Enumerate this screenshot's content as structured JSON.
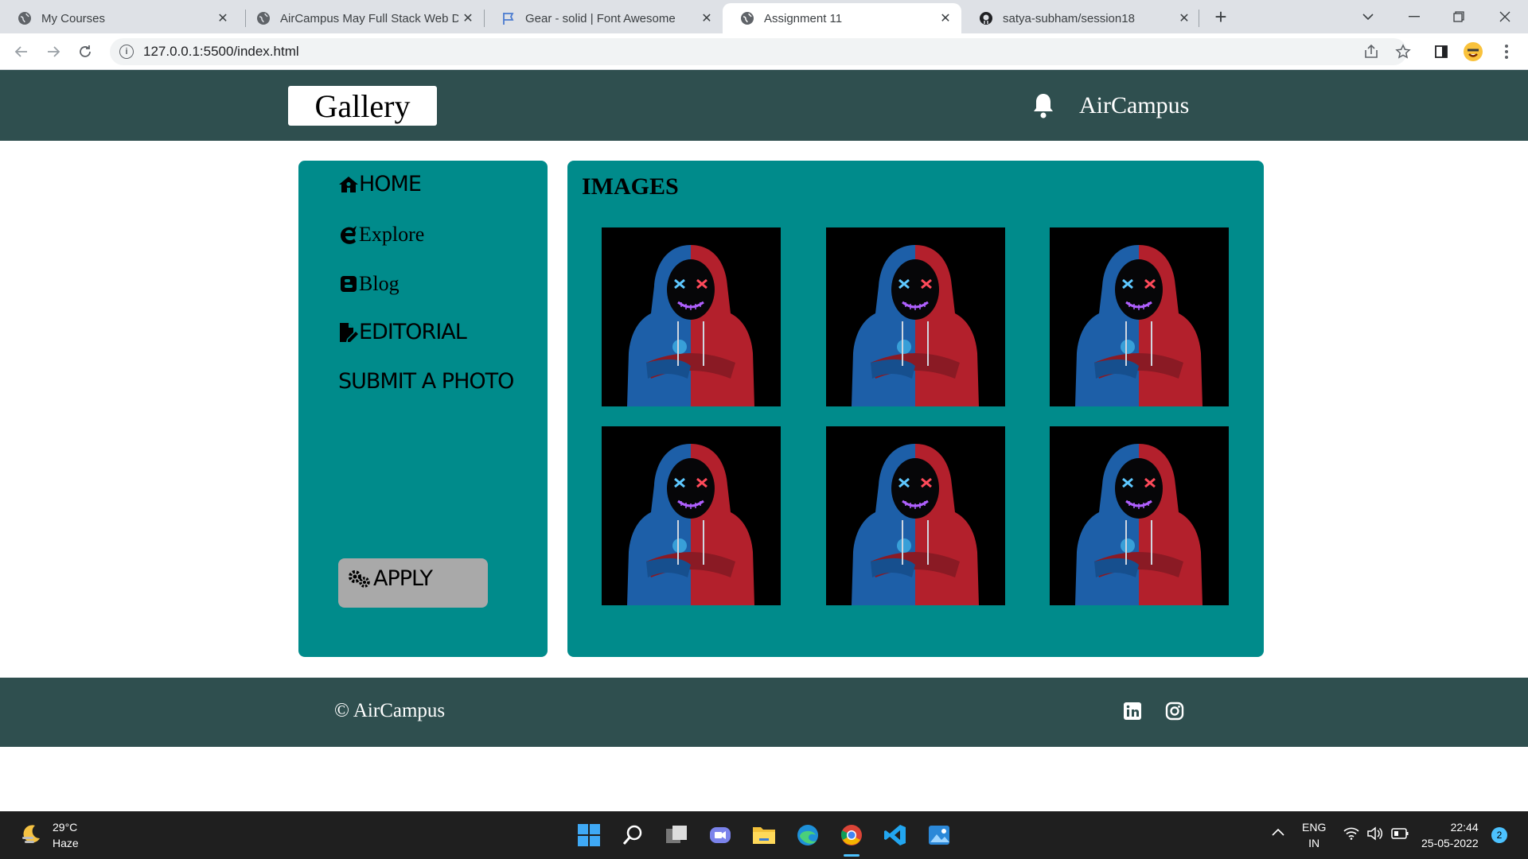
{
  "browser": {
    "tabs": [
      {
        "title": "My Courses"
      },
      {
        "title": "AirCampus May Full Stack Web D"
      },
      {
        "title": "Gear - solid | Font Awesome"
      },
      {
        "title": "Assignment 11"
      },
      {
        "title": "satya-subham/session18"
      }
    ],
    "address": "127.0.0.1:5500/index.html"
  },
  "header": {
    "logo": "Gallery",
    "brand": "AirCampus"
  },
  "sidebar": {
    "items": [
      {
        "label": "HOME",
        "icon": "house-icon"
      },
      {
        "label": "Explore",
        "icon": "internet-explorer-icon"
      },
      {
        "label": "Blog",
        "icon": "blogger-icon"
      },
      {
        "label": "EDITORIAL",
        "icon": "file-pen-icon"
      },
      {
        "label": "SUBMIT A PHOTO",
        "icon": ""
      }
    ],
    "apply_label": "APPLY"
  },
  "main": {
    "title": "IMAGES",
    "image_count": 6
  },
  "footer": {
    "copyright": "© AirCampus"
  },
  "taskbar": {
    "temperature": "29°C",
    "condition": "Haze",
    "lang_top": "ENG",
    "lang_bottom": "IN",
    "time": "22:44",
    "date": "25-05-2022",
    "notifications": "2"
  },
  "colors": {
    "header_bg": "#2f4f4f",
    "panel_bg": "#008b8b",
    "apply_bg": "#a9a9a9"
  }
}
